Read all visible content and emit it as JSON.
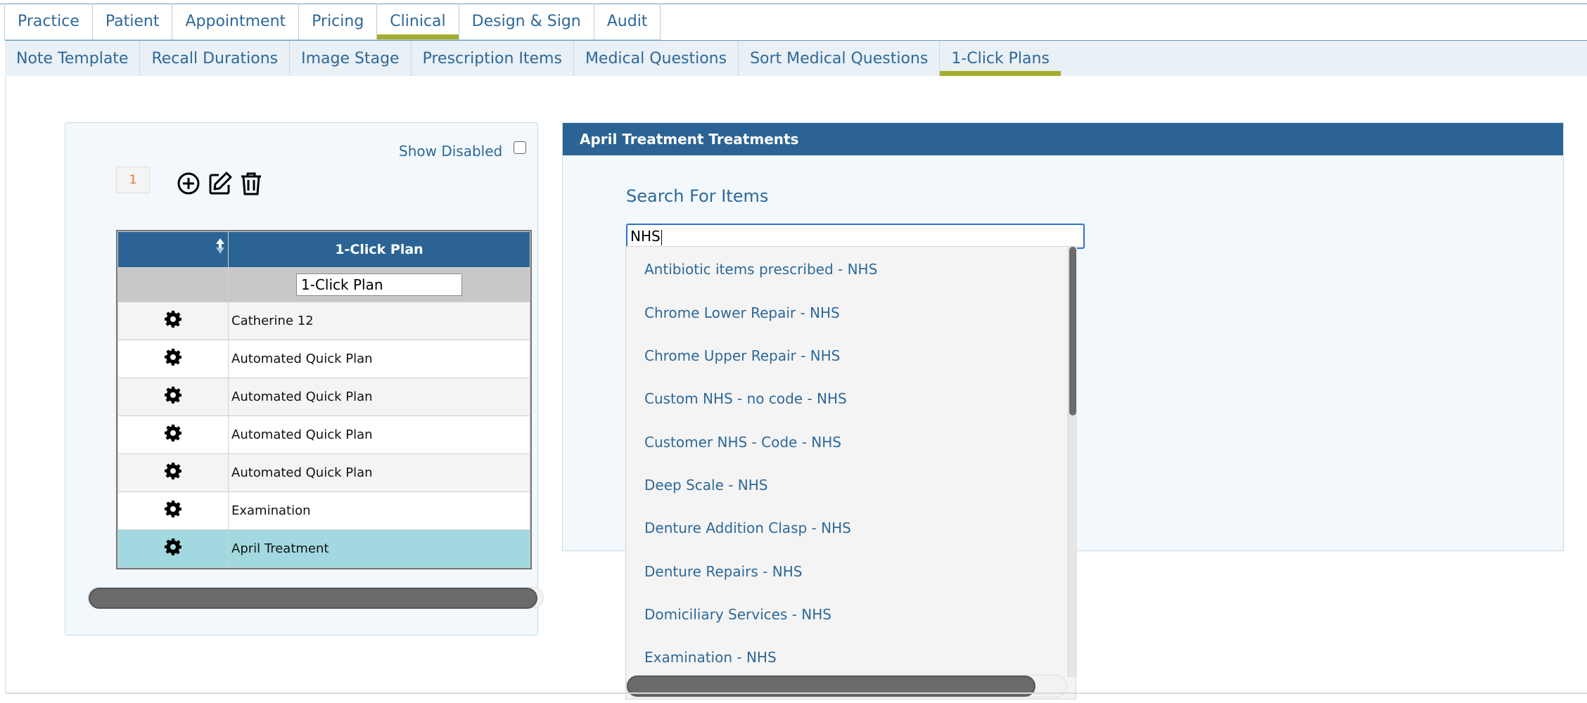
{
  "main_tabs": [
    {
      "label": "Practice",
      "active": false
    },
    {
      "label": "Patient",
      "active": false
    },
    {
      "label": "Appointment",
      "active": false
    },
    {
      "label": "Pricing",
      "active": false
    },
    {
      "label": "Clinical",
      "active": true
    },
    {
      "label": "Design & Sign",
      "active": false
    },
    {
      "label": "Audit",
      "active": false
    }
  ],
  "sub_tabs": [
    {
      "label": "Note Template",
      "active": false
    },
    {
      "label": "Recall Durations",
      "active": false
    },
    {
      "label": "Image Stage",
      "active": false
    },
    {
      "label": "Prescription Items",
      "active": false
    },
    {
      "label": "Medical Questions",
      "active": false
    },
    {
      "label": "Sort Medical Questions",
      "active": false
    },
    {
      "label": "1-Click Plans",
      "active": true
    }
  ],
  "left_panel": {
    "show_disabled_label": "Show Disabled",
    "show_disabled_checked": false,
    "page_number": "1",
    "icons": [
      "add-circle-icon",
      "edit-icon",
      "trash-icon"
    ],
    "grid": {
      "columns": [
        "",
        "1-Click Plan"
      ],
      "filter_value": "1-Click Plan",
      "rows": [
        {
          "name": "Catherine 12",
          "selected": false
        },
        {
          "name": "Automated Quick Plan",
          "selected": false
        },
        {
          "name": "Automated Quick Plan",
          "selected": false
        },
        {
          "name": "Automated Quick Plan",
          "selected": false
        },
        {
          "name": "Automated Quick Plan",
          "selected": false
        },
        {
          "name": "Examination",
          "selected": false
        },
        {
          "name": "April Treatment",
          "selected": true
        }
      ],
      "row_icon": "gear-icon"
    }
  },
  "right_panel": {
    "title": "April Treatment Treatments",
    "search_label": "Search For Items",
    "search_value": "NHS",
    "dropdown_items": [
      "Antibiotic items prescribed - NHS",
      "Chrome Lower Repair - NHS",
      "Chrome Upper Repair - NHS",
      "Custom NHS - no code - NHS",
      "Customer NHS - Code - NHS",
      "Deep Scale - NHS",
      "Denture Addition Clasp - NHS",
      "Denture Repairs - NHS",
      "Domiciliary Services - NHS",
      "Examination - NHS"
    ]
  },
  "colors": {
    "brand_blue": "#2b6494",
    "link_blue": "#2d6899",
    "active_tab_underline": "#a4ad2c",
    "selected_row": "#a2d9e0",
    "page_number_orange": "#e0702a"
  }
}
